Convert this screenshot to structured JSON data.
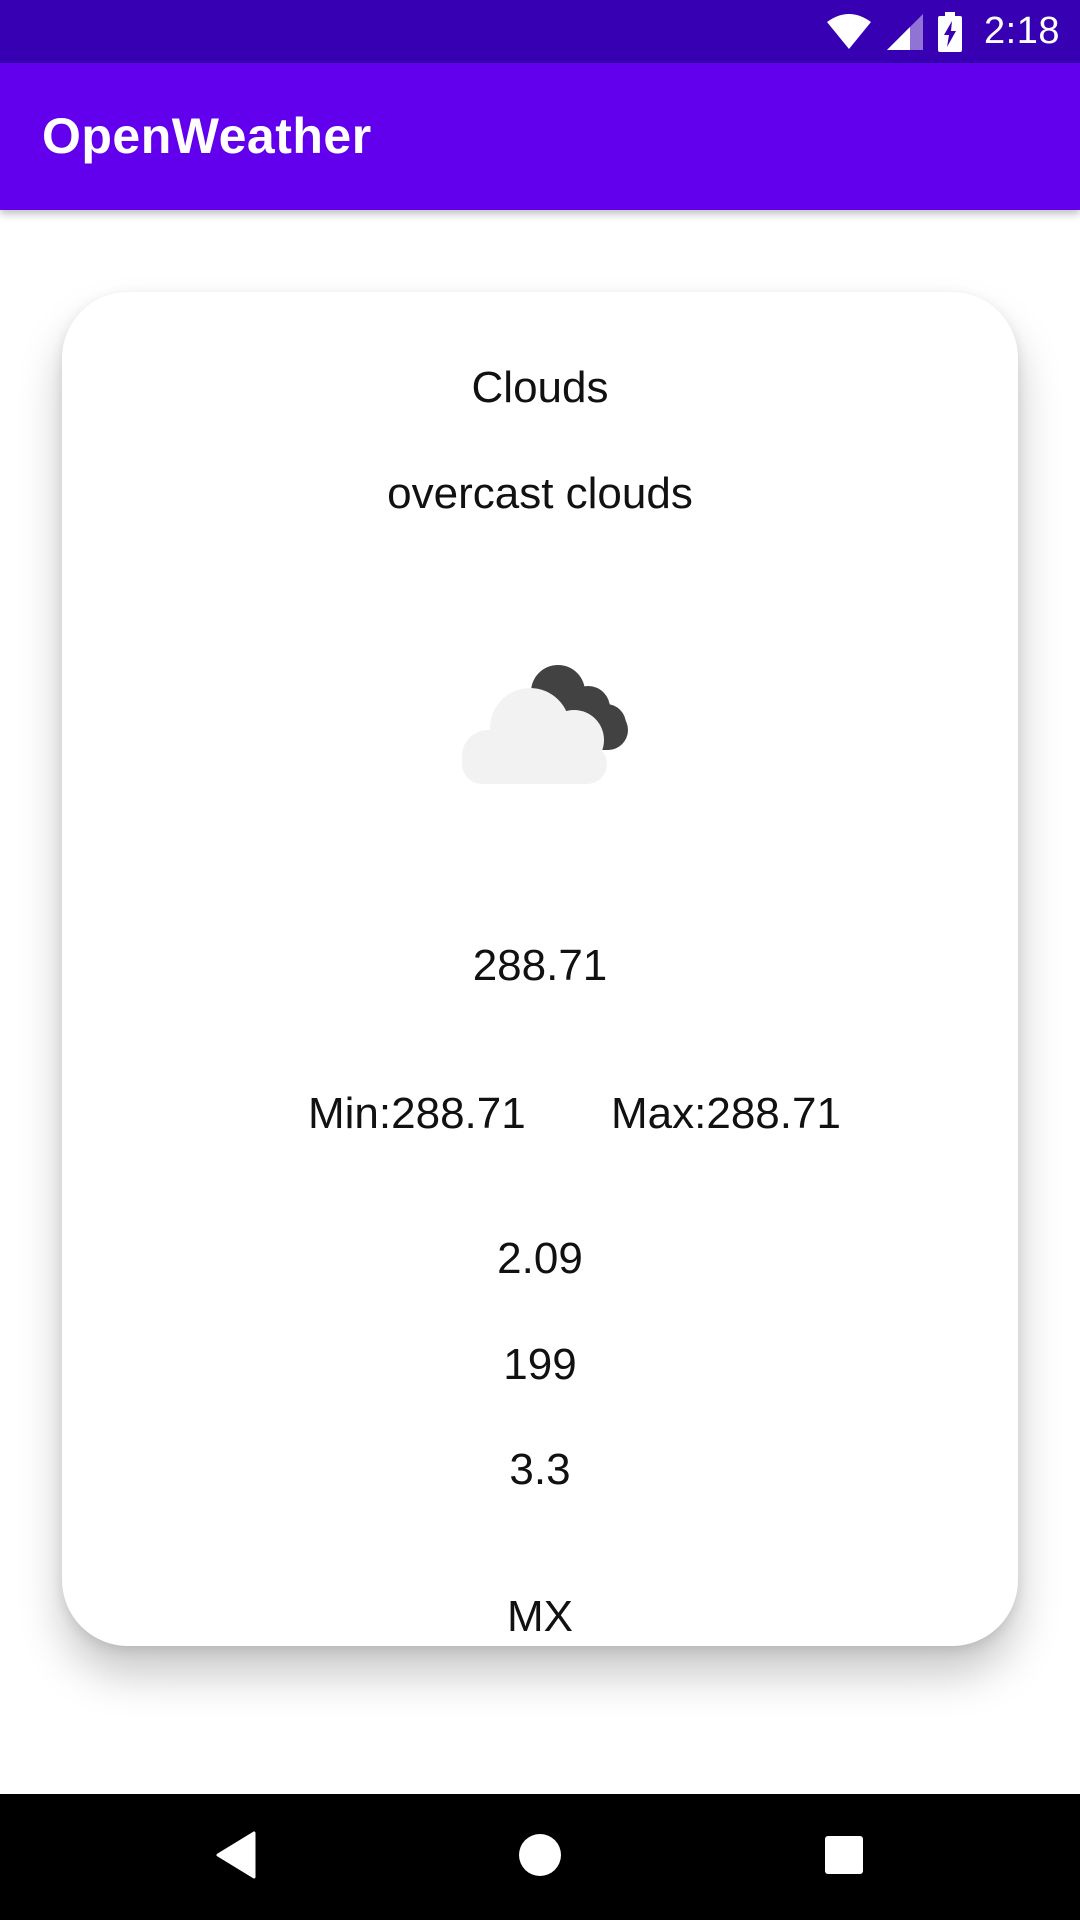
{
  "status_bar": {
    "time": "2:18",
    "icons": [
      "wifi-icon",
      "signal-icon",
      "battery-charging-icon"
    ]
  },
  "app_bar": {
    "title": "OpenWeather"
  },
  "weather": {
    "main": "Clouds",
    "description": "overcast clouds",
    "icon": "overcast-clouds-icon",
    "temp": "288.71",
    "min": "Min:288.71",
    "max": "Max:288.71",
    "wind_speed": "2.09",
    "wind_deg": "199",
    "gust": "3.3",
    "country": "MX"
  },
  "nav_bar": {
    "buttons": [
      "back-icon",
      "home-icon",
      "recents-icon"
    ]
  },
  "colors": {
    "status_bar": "#3700B3",
    "app_bar": "#6200EE",
    "nav_bar": "#000000"
  }
}
